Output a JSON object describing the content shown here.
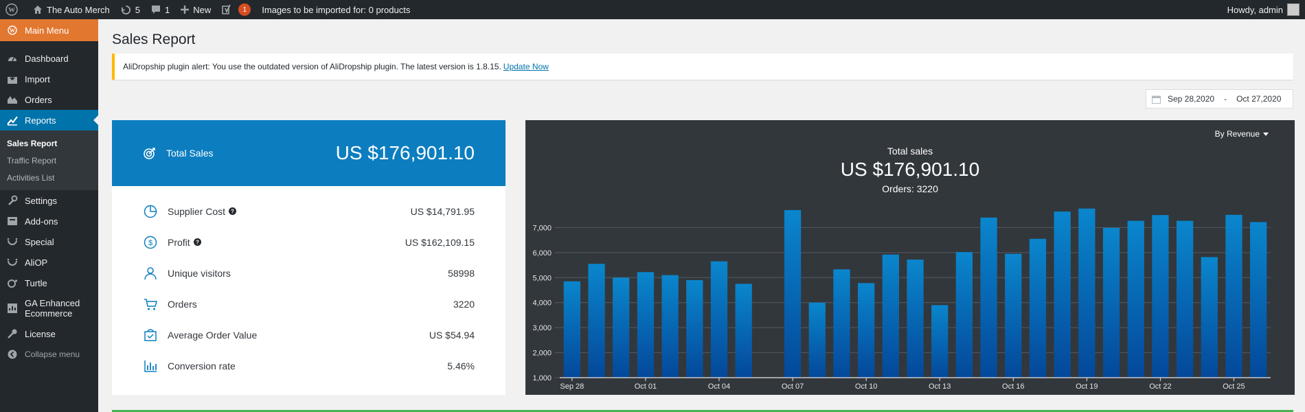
{
  "adminbar": {
    "site_name": "The Auto Merch",
    "updates_count": "5",
    "comments_count": "1",
    "new_label": "New",
    "yoast_badge": "1",
    "import_notice": "Images to be imported for: 0 products",
    "howdy": "Howdy, admin"
  },
  "sidebar": {
    "main_menu": "Main Menu",
    "items": [
      {
        "label": "Dashboard",
        "icon": "dashboard-icon"
      },
      {
        "label": "Import",
        "icon": "import-icon"
      },
      {
        "label": "Orders",
        "icon": "orders-icon"
      },
      {
        "label": "Reports",
        "icon": "reports-icon"
      }
    ],
    "submenu": [
      "Sales Report",
      "Traffic Report",
      "Activities List"
    ],
    "items2": [
      {
        "label": "Settings",
        "icon": "wrench-icon"
      },
      {
        "label": "Add-ons",
        "icon": "addons-icon"
      },
      {
        "label": "Special",
        "icon": "special-icon"
      },
      {
        "label": "AliOP",
        "icon": "aliop-icon"
      },
      {
        "label": "Turtle",
        "icon": "turtle-icon"
      },
      {
        "label": "GA Enhanced Ecommerce",
        "icon": "ga-icon"
      },
      {
        "label": "License",
        "icon": "key-icon"
      }
    ],
    "collapse": "Collapse menu"
  },
  "page": {
    "title": "Sales Report",
    "notice_text": "AliDropship plugin alert: You use the outdated version of AliDropship plugin. The latest version is 1.8.15.",
    "notice_link": "Update Now",
    "date_from": "Sep 28,2020",
    "date_sep": "-",
    "date_to": "Oct 27,2020"
  },
  "summary": {
    "total_label": "Total Sales",
    "total_value": "US $176,901.10",
    "metrics": [
      {
        "label": "Supplier Cost",
        "value": "US $14,791.95"
      },
      {
        "label": "Profit",
        "value": "US $162,109.15"
      },
      {
        "label": "Unique visitors",
        "value": "58998"
      },
      {
        "label": "Orders",
        "value": "3220"
      },
      {
        "label": "Average Order Value",
        "value": "US $54.94"
      },
      {
        "label": "Conversion rate",
        "value": "5.46%"
      }
    ]
  },
  "chart_panel": {
    "dropdown": "By Revenue",
    "title": "Total sales",
    "value": "US $176,901.10",
    "orders": "Orders: 3220"
  },
  "colors": {
    "accent": "#0073aa",
    "brand_orange": "#e27730",
    "bar_top": "#0a86cc",
    "bar_bottom": "#04489a",
    "panel_bg": "#32373c"
  },
  "chart_data": {
    "type": "bar",
    "categories": [
      "Sep 28",
      "Sep 29",
      "Sep 30",
      "Oct 01",
      "Oct 02",
      "Oct 03",
      "Oct 04",
      "Oct 05",
      "Oct 06",
      "Oct 07",
      "Oct 08",
      "Oct 09",
      "Oct 10",
      "Oct 11",
      "Oct 12",
      "Oct 13",
      "Oct 14",
      "Oct 15",
      "Oct 16",
      "Oct 17",
      "Oct 18",
      "Oct 19",
      "Oct 20",
      "Oct 21",
      "Oct 22",
      "Oct 23",
      "Oct 24",
      "Oct 25",
      "Oct 26"
    ],
    "values": [
      4850,
      5550,
      5000,
      5220,
      5100,
      4900,
      5650,
      4750,
      null,
      7700,
      4000,
      5330,
      4780,
      5920,
      5720,
      3900,
      6020,
      7400,
      5950,
      6550,
      7640,
      7760,
      6990,
      7270,
      7500,
      7270,
      5820,
      7510,
      7220
    ],
    "xticks": [
      "Sep 28",
      "Oct 01",
      "Oct 04",
      "Oct 07",
      "Oct 10",
      "Oct 13",
      "Oct 16",
      "Oct 19",
      "Oct 22",
      "Oct 25"
    ],
    "yticks": [
      "1,000",
      "2,000",
      "3,000",
      "4,000",
      "5,000",
      "6,000",
      "7,000"
    ],
    "ylim": [
      1000,
      8000
    ],
    "grid": true
  }
}
